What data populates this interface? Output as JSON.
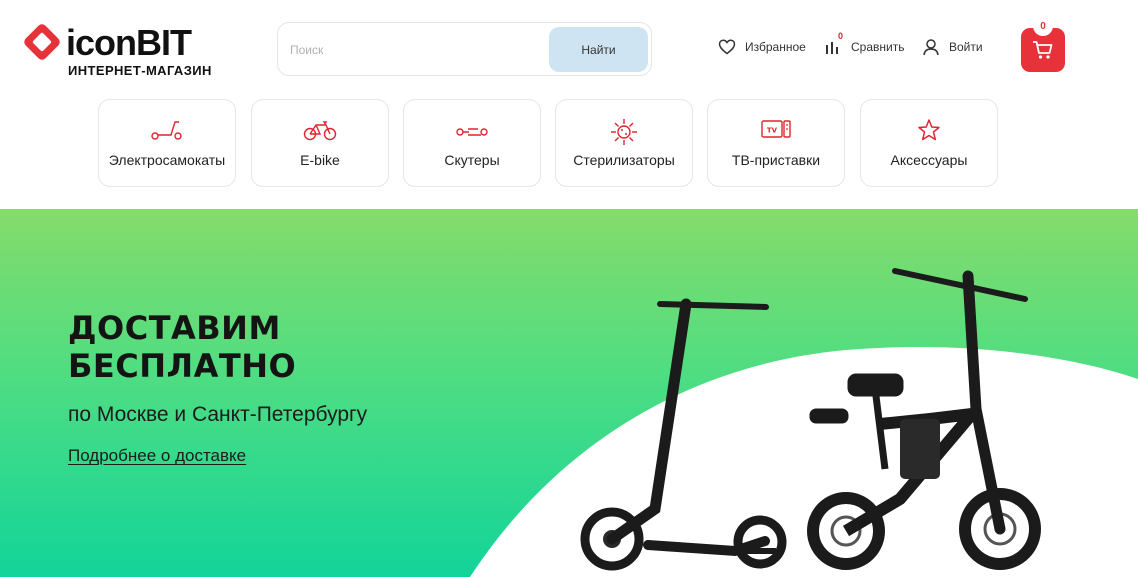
{
  "brand": {
    "name": "iconBIT",
    "tagline": "ИНТЕРНЕТ-МАГАЗИН",
    "accent": "#e73239"
  },
  "search": {
    "placeholder": "Поиск",
    "button_label": "Найти"
  },
  "header_links": {
    "favorites": {
      "label": "Избранное",
      "icon": "heart-icon"
    },
    "compare": {
      "label": "Сравнить",
      "icon": "bar-chart-icon",
      "count": "0"
    },
    "login": {
      "label": "Войти",
      "icon": "user-icon"
    }
  },
  "cart": {
    "count": "0",
    "icon": "cart-icon"
  },
  "categories": [
    {
      "label": "Электросамокаты",
      "icon": "scooter-icon"
    },
    {
      "label": "E-bike",
      "icon": "bicycle-icon"
    },
    {
      "label": "Скутеры",
      "icon": "moped-icon"
    },
    {
      "label": "Стерилизаторы",
      "icon": "virus-icon"
    },
    {
      "label": "ТВ-приставки",
      "icon": "tv-box-icon"
    },
    {
      "label": "Аксессуары",
      "icon": "star-icon"
    }
  ],
  "banner": {
    "title_line1": "ДОСТАВИМ",
    "title_line2": "БЕСПЛАТНО",
    "subtitle": "по Москве и Санкт-Петербургу",
    "link_label": "Подробнее о доставке",
    "colors": {
      "top": "#85dc6a",
      "bottom": "#12d49a"
    }
  }
}
